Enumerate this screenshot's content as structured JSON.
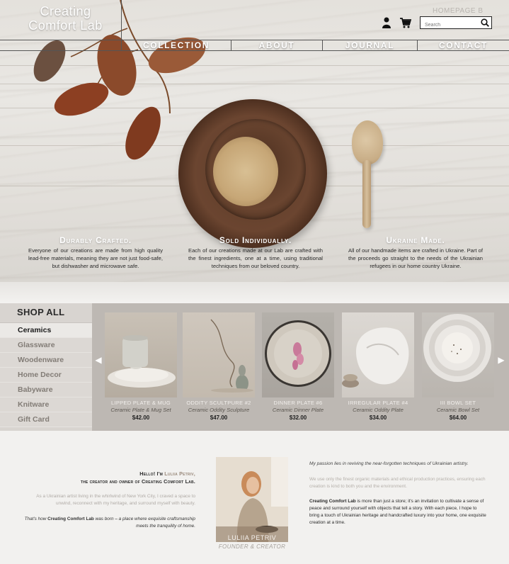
{
  "brand": {
    "name": "Creating Comfort Lab"
  },
  "header": {
    "homepage_tag": "HOMEPAGE B",
    "search_placeholder": "Search",
    "nav": [
      "COLLECTION",
      "ABOUT",
      "JOURNAL",
      "CONTACT"
    ],
    "icons": [
      "user-icon",
      "cart-icon",
      "search-icon"
    ]
  },
  "features": [
    {
      "title": "Durably Crafted.",
      "body": "Everyone of our creations are made from high quality lead-free materials, meaning they are not just food-safe, but dishwasher and microwave safe."
    },
    {
      "title": "Sold Individually.",
      "body": "Each of our creations made at our Lab are crafted with the finest ingredients, one at a time, using traditional techniques from our beloved country."
    },
    {
      "title": "Ukraine Made.",
      "body": "All of our handmade items are crafted in Ukraine. Part of the proceeds go straight to the needs of the Ukrainian refugees in our home country Ukraine."
    }
  ],
  "shop": {
    "heading": "SHOP ALL",
    "categories": [
      "Ceramics",
      "Glassware",
      "Woodenware",
      "Home Decor",
      "Babyware",
      "Knitware",
      "Gift Card"
    ],
    "active_category": "Ceramics",
    "prev_arrow": "◀",
    "next_arrow": "▶",
    "products": [
      {
        "name": "LIPPED PLATE & MUG",
        "subtitle": "Ceramic Plate & Mug Set",
        "price": "$42.00"
      },
      {
        "name": "ODDITY SCULTPURE #2",
        "subtitle": "Ceramic Oddity Sculpture",
        "price": "$47.00"
      },
      {
        "name": "DINNER PLATE #6",
        "subtitle": "Ceramic Dinner Plate",
        "price": "$32.00"
      },
      {
        "name": "IRREGULAR PLATE #4",
        "subtitle": "Ceramic Oddity Plate",
        "price": "$34.00"
      },
      {
        "name": "III BOWL SET",
        "subtitle": "Ceramic Bowl Set",
        "price": "$64.00"
      }
    ]
  },
  "about": {
    "hello_prefix": "Hello! I'm",
    "owner_name": "Luliia Petriv,",
    "owner_line": "the creator and owner of Creating Comfort Lab.",
    "bio_muted": "As a Ukrainian artist living in the whirlwind of New York City, I craved a space to unwind, reconnect with my heritage, and surround myself with beauty.",
    "born_prefix": "That's how",
    "born_brand": "Creating Comfort Lab",
    "born_suffix": "was born – a place where exquisite craftsmanship meets the tranquility of home.",
    "portrait_name": "LULIIA PETRIV",
    "portrait_role": "FOUNDER & CREATOR",
    "passion": "My passion lies in reviving the near-forgotten techniques of Ukrainian artistry.",
    "organic": "We use only the finest organic materials and ethical production practices, ensuring each creation is kind to both you and the environment.",
    "story_brand": "Creating Comfort Lab",
    "story": "is more than just a store; it's an invitation to cultivate a sense of peace and surround yourself with objects that tell a story. With each piece, I hope to bring a touch of Ukrainian heritage and handcrafted luxury into your home, one exquisite creation at a time."
  },
  "colors": {
    "hero_text": "#ffffff",
    "shop_band": "#bdb8b3",
    "sidebar": "#d8d4d0",
    "accent": "#9a8a7c"
  }
}
